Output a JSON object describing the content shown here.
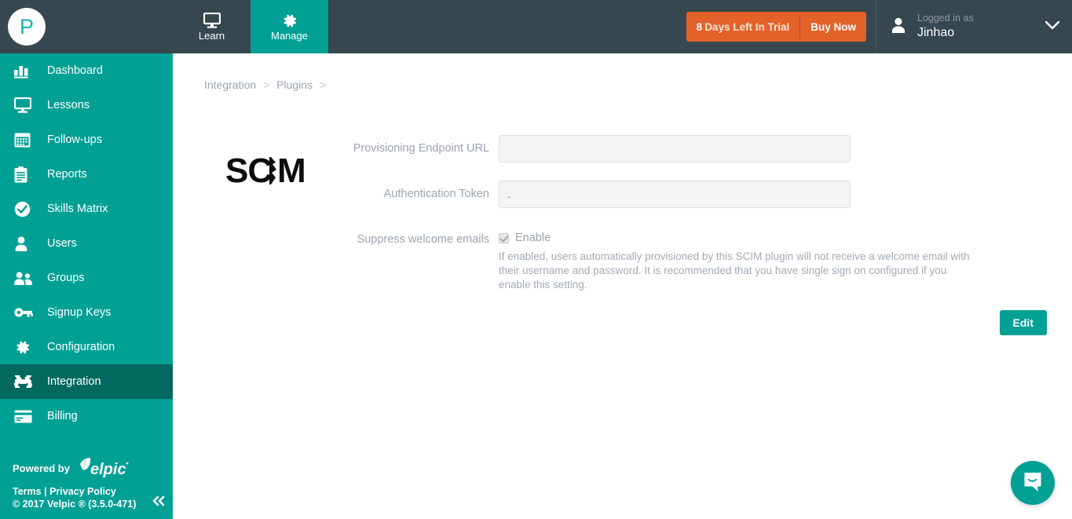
{
  "header": {
    "logo_letter": "P",
    "tabs": [
      {
        "label": "Learn",
        "icon": "monitor-icon",
        "active": false
      },
      {
        "label": "Manage",
        "icon": "gear-icon",
        "active": true
      }
    ],
    "trial": {
      "days": "8",
      "days_text": "Days Left In Trial",
      "full_text": "8 Days Left In Trial",
      "buy_label": "Buy Now",
      "color": "#e2622a"
    },
    "user": {
      "logged_in_label": "Logged in as",
      "name": "Jinhao",
      "icon": "person-icon",
      "caret": "chevron-down-icon"
    },
    "bg_color": "#36474f"
  },
  "sidebar": {
    "bg_color": "#00a094",
    "active_color": "#03685f",
    "items": [
      {
        "label": "Dashboard",
        "icon": "bar-chart-icon",
        "active": false
      },
      {
        "label": "Lessons",
        "icon": "monitor-icon",
        "active": false
      },
      {
        "label": "Follow-ups",
        "icon": "calendar-icon",
        "active": false
      },
      {
        "label": "Reports",
        "icon": "clipboard-icon",
        "active": false
      },
      {
        "label": "Skills Matrix",
        "icon": "check-circle-icon",
        "active": false
      },
      {
        "label": "Users",
        "icon": "person-icon",
        "active": false
      },
      {
        "label": "Groups",
        "icon": "people-icon",
        "active": false
      },
      {
        "label": "Signup Keys",
        "icon": "key-icon",
        "active": false
      },
      {
        "label": "Configuration",
        "icon": "gear-icon",
        "active": false
      },
      {
        "label": "Integration",
        "icon": "puzzle-icon",
        "active": true
      },
      {
        "label": "Billing",
        "icon": "credit-card-icon",
        "active": false
      }
    ],
    "footer": {
      "powered_by": "Powered by",
      "brand": "velpic",
      "terms": "Terms",
      "separator": "|",
      "privacy": "Privacy Policy",
      "copyright": "© 2017 Velpic ® (3.5.0-471)",
      "collapse_icon": "double-chevron-left-icon"
    }
  },
  "breadcrumb": {
    "items": [
      "Integration",
      "Plugins"
    ],
    "separator": ">"
  },
  "plugin": {
    "logo_text": "SCIM",
    "fields": [
      {
        "label": "Provisioning Endpoint URL",
        "value": "",
        "placeholder": ""
      },
      {
        "label": "Authentication Token",
        "value": ".",
        "placeholder": ""
      }
    ],
    "checkbox": {
      "label": "Suppress welcome emails",
      "option_label": "Enable",
      "checked": true,
      "help_text": "If enabled, users automatically provisioned by this SCIM plugin will not receive a welcome email with their username and password. It is recommended that you have single sign on configured if you enable this setting."
    },
    "edit_button": "Edit"
  },
  "chat": {
    "icon": "chat-bubble-smile-icon",
    "color": "#00a094"
  }
}
